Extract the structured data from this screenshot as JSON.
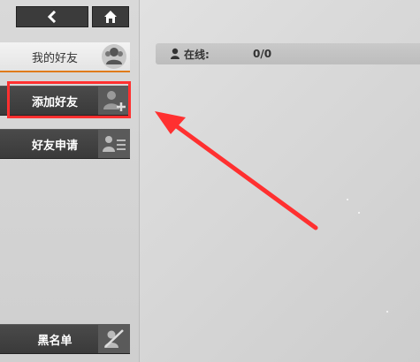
{
  "header": {
    "back_icon": "chevron-left-icon",
    "home_icon": "home-icon"
  },
  "sidebar": {
    "items": [
      {
        "label": "我的好友",
        "icon": "friends-group-icon",
        "active": true
      },
      {
        "label": "添加好友",
        "icon": "add-friend-icon",
        "active": false,
        "highlighted": true
      },
      {
        "label": "好友申请",
        "icon": "friend-request-list-icon",
        "active": false
      },
      {
        "label": "黑名单",
        "icon": "blacklist-block-icon",
        "active": false
      }
    ]
  },
  "status": {
    "icon": "person-pin-icon",
    "online_label": "在线:",
    "online_value": "0/0"
  },
  "annotation": {
    "color": "#ff3030",
    "type": "arrow-pointing-to-add-friend"
  },
  "colors": {
    "accent": "#e07b1a",
    "dark_button": "#3b3b3b",
    "highlight": "#ff3030"
  }
}
